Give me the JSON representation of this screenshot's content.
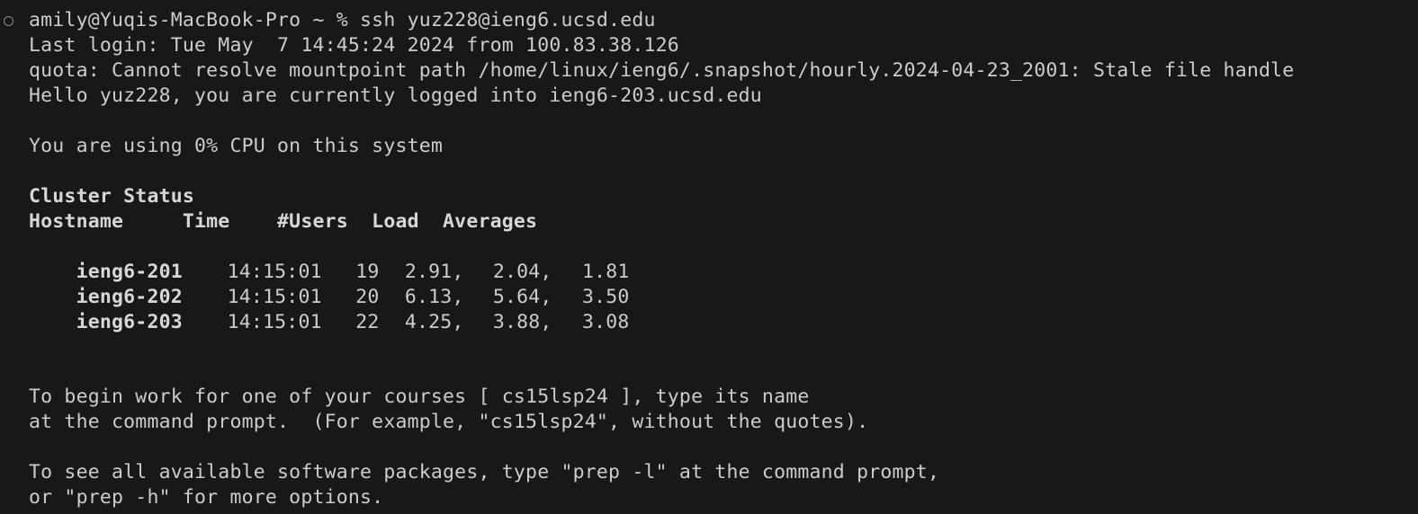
{
  "terminal": {
    "prompt_line": "amily@Yuqis-MacBook-Pro ~ % ssh yuz228@ieng6.ucsd.edu",
    "last_login": "Last login: Tue May  7 14:45:24 2024 from 100.83.38.126",
    "quota_msg": "quota: Cannot resolve mountpoint path /home/linux/ieng6/.snapshot/hourly.2024-04-23_2001: Stale file handle",
    "hello": "Hello yuz228, you are currently logged into ieng6-203.ucsd.edu",
    "cpu": "You are using 0% CPU on this system",
    "cluster_title": "Cluster Status",
    "cluster_header": "Hostname     Time    #Users  Load  Averages",
    "cluster_rows": [
      {
        "host": "ieng6-201",
        "time": "14:15:01",
        "users": "19",
        "l1": "2.91,",
        "l2": "2.04,",
        "l3": "1.81"
      },
      {
        "host": "ieng6-202",
        "time": "14:15:01",
        "users": "20",
        "l1": "6.13,",
        "l2": "5.64,",
        "l3": "3.50"
      },
      {
        "host": "ieng6-203",
        "time": "14:15:01",
        "users": "22",
        "l1": "4.25,",
        "l2": "3.88,",
        "l3": "3.08"
      }
    ],
    "course_line1": "To begin work for one of your courses [ cs15lsp24 ], type its name",
    "course_line2": "at the command prompt.  (For example, \"cs15lsp24\", without the quotes).",
    "software_line1": "To see all available software packages, type \"prep -l\" at the command prompt,",
    "software_line2": "or \"prep -h\" for more options."
  }
}
